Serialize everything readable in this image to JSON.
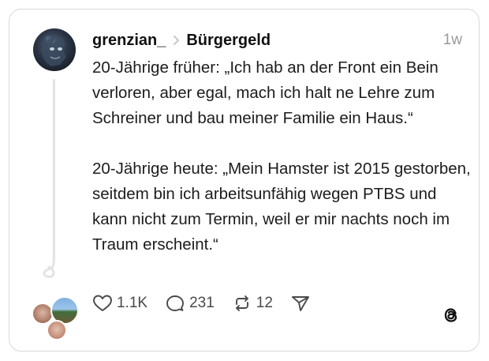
{
  "post": {
    "username": "grenzian_",
    "topic": "Bürgergeld",
    "time": "1w",
    "paragraphs": [
      "20-Jährige früher: „Ich hab an der Front ein Bein verloren, aber egal, mach ich halt ne Lehre zum Schreiner und bau meiner Familie ein Haus.“",
      "20-Jährige heute: „Mein Hamster ist 2015 gestorben, seitdem bin ich arbeitsunfähig wegen PTBS und kann nicht zum Termin, weil er mir nachts noch im Traum erscheint.“"
    ]
  },
  "actions": {
    "likes": "1.1K",
    "replies": "231",
    "reposts": "12"
  },
  "icons": {
    "like": "heart-icon",
    "reply": "comment-icon",
    "repost": "repost-icon",
    "share": "send-icon",
    "brand": "threads-logo",
    "separator": "chevron-right-icon"
  },
  "colors": {
    "text": "#1c1c1c",
    "muted": "#9a9a9a",
    "border": "#d9d9d9",
    "thread_line": "#e3e3e3"
  }
}
